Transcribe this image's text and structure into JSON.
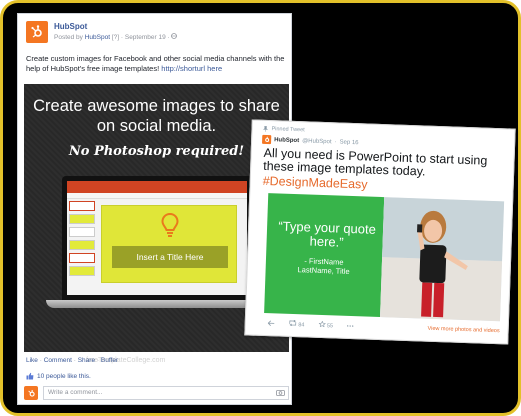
{
  "colors": {
    "frame_border": "#e3c12a",
    "hubspot_orange": "#f47622",
    "facebook_blue": "#3b5998",
    "slide_yellow": "#e0e638",
    "quote_green": "#37b44a",
    "hashtag_orange": "#e66a2c"
  },
  "facebook_post": {
    "page_name": "HubSpot",
    "posted_by_prefix": "Posted by",
    "posted_by_name": "HubSpot",
    "posted_by_mark": "[?]",
    "date": "September 19",
    "privacy_icon": "globe-icon",
    "body_text": "Create custom images for Facebook and other social media channels with the help of HubSpot's free image templates!",
    "link_text": "http://shorturl here",
    "image": {
      "headline": "Create awesome images to share on social media.",
      "subhead": "No Photoshop required!",
      "slide_title": "Insert a Title Here"
    },
    "actions": {
      "like": "Like",
      "comment": "Comment",
      "share": "Share",
      "buffer": "Buffer",
      "separator": "·"
    },
    "likes_text": "10 people like this.",
    "comment_placeholder": "Write a comment..."
  },
  "tweet": {
    "pinned_label": "Pinned Tweet",
    "name": "HubSpot",
    "handle": "@HubSpot",
    "date": "Sep 16",
    "text": "All you need is PowerPoint to start using these image templates today.",
    "hashtag": "#DesignMadeEasy",
    "quote": "“Type your quote here.”",
    "attribution_line1": "- FirstName",
    "attribution_line2": "LastName, Title",
    "retweet_count": "84",
    "favorite_count": "55",
    "view_more": "View more photos and videos"
  },
  "watermark": "freeTemplateCollege.com"
}
